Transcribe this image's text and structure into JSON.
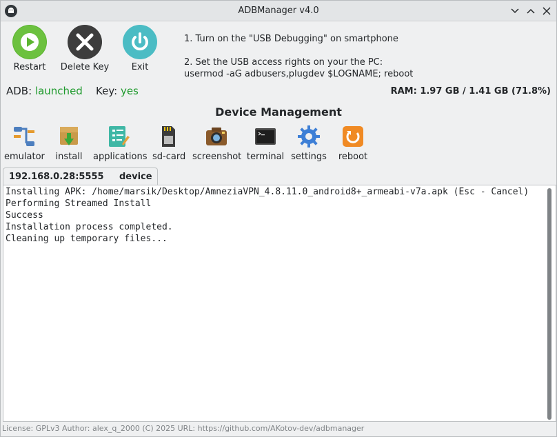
{
  "window": {
    "title": "ADBManager v4.0",
    "controls": [
      "minimize",
      "maximize",
      "close"
    ]
  },
  "top_buttons": {
    "restart_label": "Restart",
    "delete_key_label": "Delete Key",
    "exit_label": "Exit"
  },
  "instructions": {
    "line1": "1. Turn on the \"USB Debugging\" on smartphone",
    "line2": "2. Set the USB access rights on your the PC:",
    "line3": "usermod -aG adbusers,plugdev $LOGNAME; reboot"
  },
  "status": {
    "adb_label": "ADB:",
    "adb_value": "launched",
    "key_label": "Key:",
    "key_value": "yes",
    "ram": "RAM: 1.97 GB / 1.41 GB (71.8%)"
  },
  "section_title": "Device Management",
  "toolbar": [
    {
      "label": "emulator",
      "icon": "emulator-icon"
    },
    {
      "label": "install",
      "icon": "install-icon"
    },
    {
      "label": "applications",
      "icon": "applications-icon"
    },
    {
      "label": "sd-card",
      "icon": "sd-card-icon"
    },
    {
      "label": "screenshot",
      "icon": "camera-icon"
    },
    {
      "label": "terminal",
      "icon": "terminal-icon"
    },
    {
      "label": "settings",
      "icon": "gear-icon"
    },
    {
      "label": "reboot",
      "icon": "reboot-icon"
    }
  ],
  "tab": {
    "address": "192.168.0.28:5555",
    "type": "device"
  },
  "console": [
    "Installing APK: /home/marsik/Desktop/AmneziaVPN_4.8.11.0_android8+_armeabi-v7a.apk (Esc - Cancel)",
    "Performing Streamed Install",
    "Success",
    "Installation process completed.",
    "Cleaning up temporary files..."
  ],
  "footer": "License: GPLv3   Author: alex_q_2000 (C) 2025   URL: https://github.com/AKotov-dev/adbmanager",
  "colors": {
    "accent_green": "#1e9a2c",
    "restart_green": "#5cb531",
    "delete_dark": "#3d3d3d",
    "exit_teal": "#4bbcc4"
  }
}
